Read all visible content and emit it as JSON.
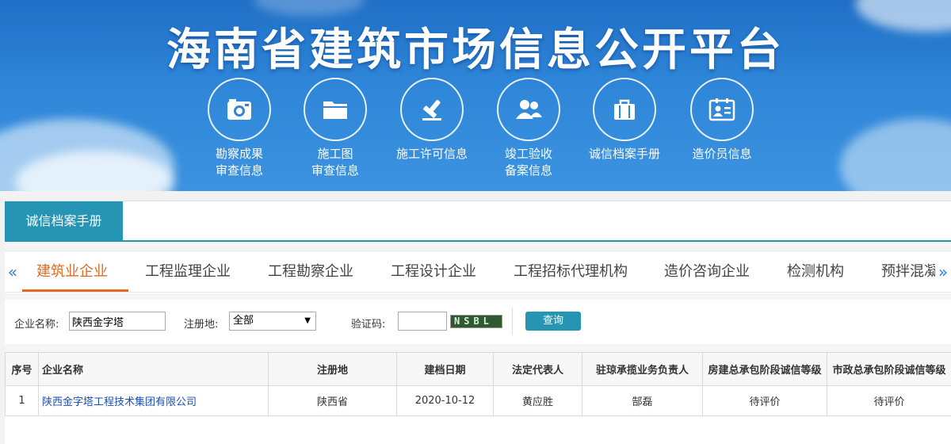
{
  "banner": {
    "title": "海南省建筑市场信息公开平台",
    "nav": [
      {
        "icon": "camera-icon",
        "label": "勘察成果\n审查信息"
      },
      {
        "icon": "folder-icon",
        "label": "施工图\n审查信息"
      },
      {
        "icon": "stamp-icon",
        "label": "施工许可信息"
      },
      {
        "icon": "users-icon",
        "label": "竣工验收\n备案信息"
      },
      {
        "icon": "briefcase-icon",
        "label": "诚信档案手册"
      },
      {
        "icon": "id-card-icon",
        "label": "造价员信息"
      }
    ]
  },
  "section": {
    "title": "诚信档案手册"
  },
  "tabs": {
    "items": [
      "建筑业企业",
      "工程监理企业",
      "工程勘察企业",
      "工程设计企业",
      "工程招标代理机构",
      "造价咨询企业",
      "检测机构",
      "预拌混凝"
    ],
    "active": "建筑业企业",
    "prev_icon": "double-chevron-left-icon",
    "next_icon": "double-chevron-right-icon"
  },
  "search": {
    "company_label": "企业名称:",
    "company_value": "陕西金字塔",
    "region_label": "注册地:",
    "region_value": "全部",
    "captcha_label": "验证码:",
    "captcha_value": "",
    "captcha_image_text": "NSBL",
    "query_label": "查询"
  },
  "table": {
    "headers": [
      "序号",
      "企业名称",
      "注册地",
      "建档日期",
      "法定代表人",
      "驻琼承揽业务负责人",
      "房建总承包阶段诚信等级",
      "市政总承包阶段诚信等级"
    ],
    "rows": [
      {
        "no": "1",
        "name": "陕西金字塔工程技术集团有限公司",
        "region": "陕西省",
        "date": "2020-10-12",
        "legal_rep": "黄应胜",
        "local_manager": "郜磊",
        "building_grade": "待评价",
        "municipal_grade": "待评价"
      }
    ]
  },
  "colors": {
    "accent": "#2595b3",
    "active_tab": "#e36a23",
    "link": "#1a4fb8",
    "banner": "#2f86d8"
  }
}
